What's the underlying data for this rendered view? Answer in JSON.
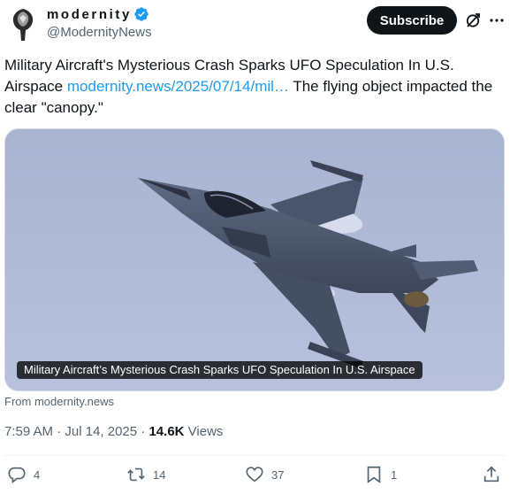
{
  "author": {
    "display_name": "modernity",
    "handle": "@ModernityNews",
    "verified": true
  },
  "header": {
    "subscribe_label": "Subscribe",
    "grok_icon": "grok-icon",
    "more_icon": "more-dots-icon"
  },
  "tweet": {
    "text_before": "Military Aircraft's Mysterious Crash Sparks UFO Speculation In U.S. Airspace ",
    "link_text": "modernity.news/2025/07/14/mil…",
    "text_after": " The flying object impacted the clear \"canopy.\""
  },
  "media": {
    "caption": "Military Aircraft’s Mysterious Crash Sparks UFO Speculation In U.S. Airspace",
    "source": "From modernity.news"
  },
  "meta": {
    "time": "7:59 AM",
    "sep1": " · ",
    "date": "Jul 14, 2025",
    "sep2": " · ",
    "views_count": "14.6K",
    "views_label": " Views"
  },
  "actions": {
    "replies": "4",
    "reposts": "14",
    "likes": "37",
    "bookmarks": "1"
  },
  "colors": {
    "link": "#1d9bf0",
    "verified": "#1d9bf0",
    "text": "#0f1419",
    "muted": "#536471"
  }
}
